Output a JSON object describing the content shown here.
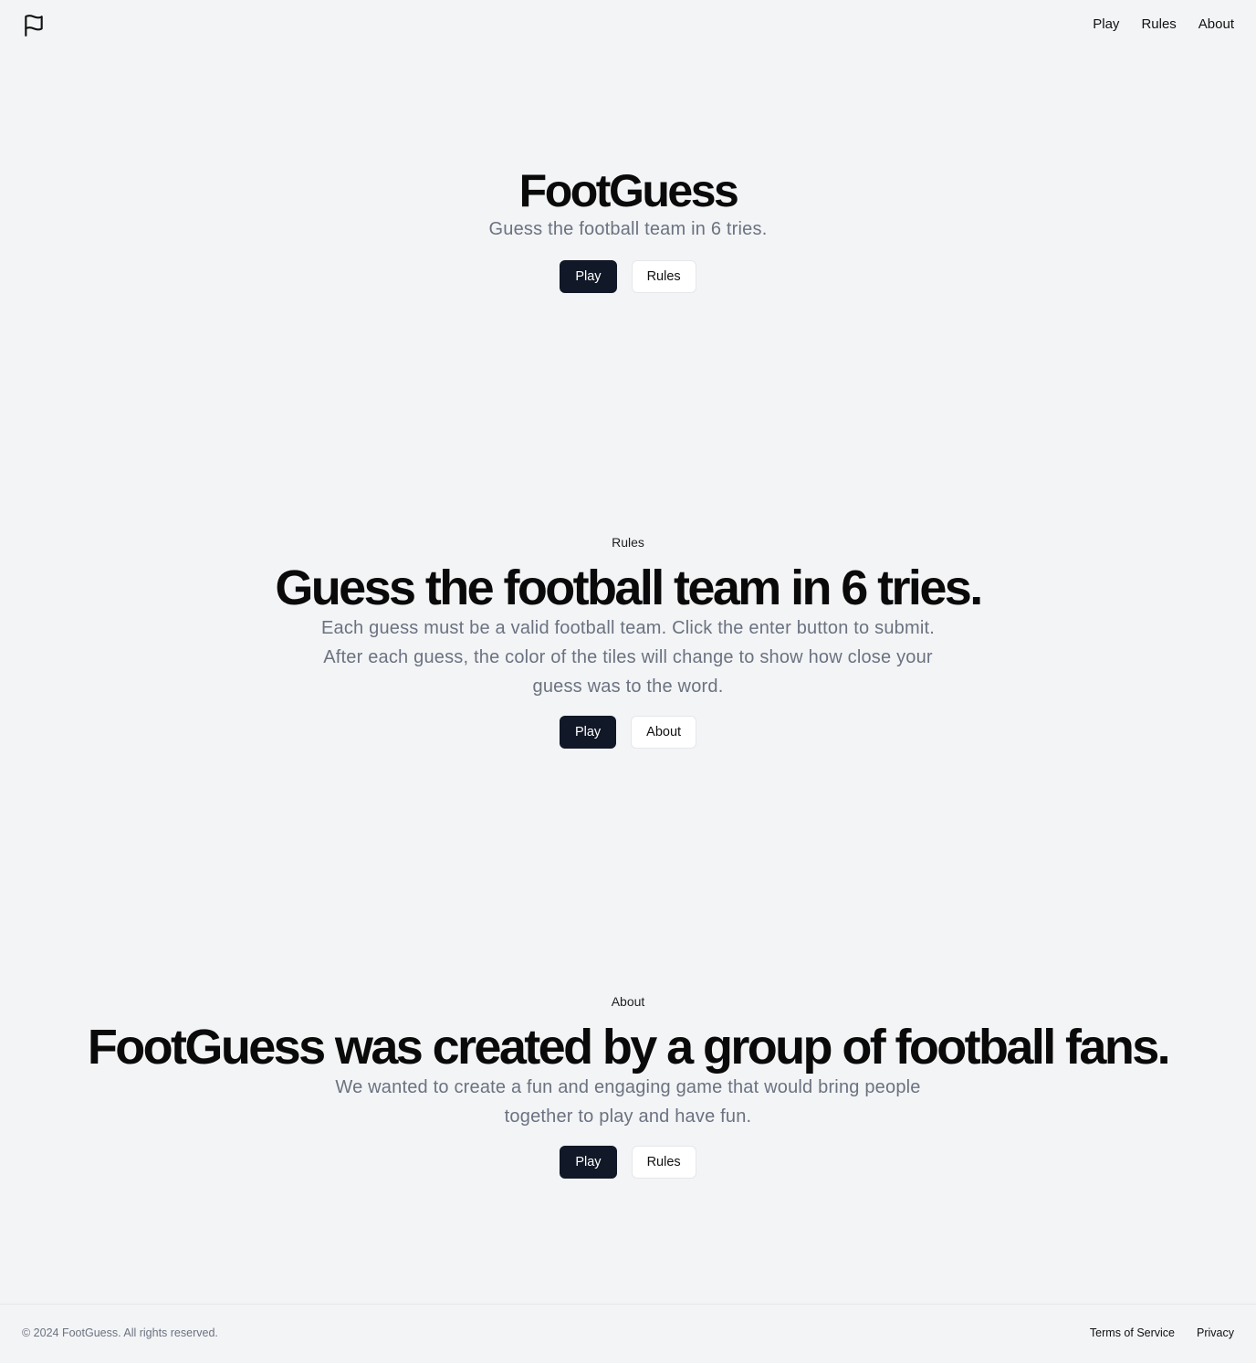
{
  "nav": {
    "logo_icon": "flag-icon",
    "links": [
      "Play",
      "Rules",
      "About"
    ]
  },
  "hero": {
    "title": "FootGuess",
    "subtitle": "Guess the football team in 6 tries.",
    "primary_button": "Play",
    "secondary_button": "Rules"
  },
  "rules": {
    "eyebrow": "Rules",
    "title": "Guess the football team in 6 tries.",
    "body": "Each guess must be a valid football team. Click the enter button to submit. After each guess, the color of the tiles will change to show how close your guess was to the word.",
    "primary_button": "Play",
    "secondary_button": "About"
  },
  "about": {
    "eyebrow": "About",
    "title": "FootGuess was created by a group of football fans.",
    "body": "We wanted to create a fun and engaging game that would bring people together to play and have fun.",
    "primary_button": "Play",
    "secondary_button": "Rules"
  },
  "footer": {
    "copyright": "© 2024 FootGuess. All rights reserved.",
    "links": [
      "Terms of Service",
      "Privacy"
    ]
  },
  "colors": {
    "background": "#f3f4f6",
    "primary_button": "#111827",
    "muted_text": "#6b7280"
  }
}
